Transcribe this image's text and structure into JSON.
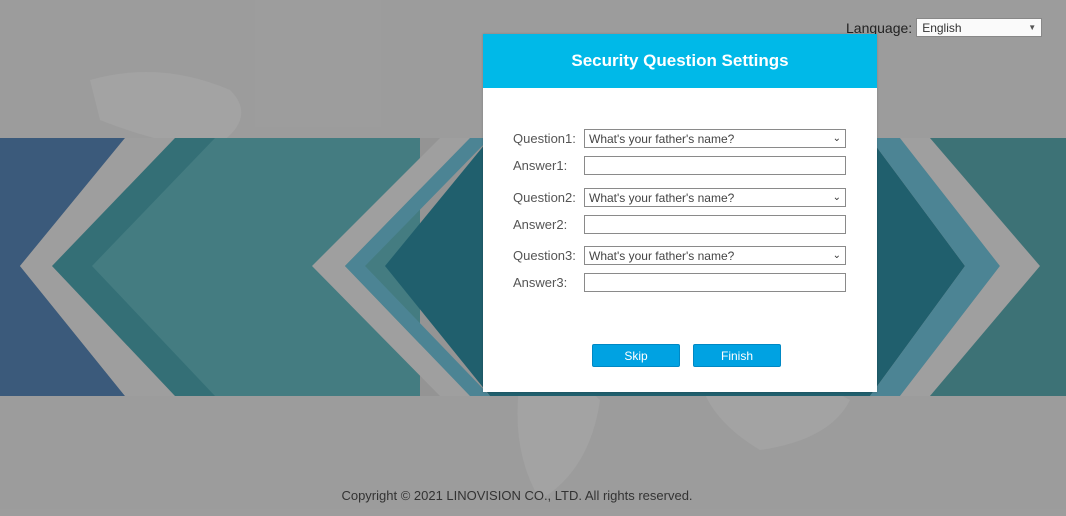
{
  "language": {
    "label": "Language:",
    "selected": "English"
  },
  "dialog": {
    "title": "Security Question Settings",
    "rows": [
      {
        "question_label": "Question1:",
        "question_value": "What's your father's name?",
        "answer_label": "Answer1:",
        "answer_value": ""
      },
      {
        "question_label": "Question2:",
        "question_value": "What's your father's name?",
        "answer_label": "Answer2:",
        "answer_value": ""
      },
      {
        "question_label": "Question3:",
        "question_value": "What's your father's name?",
        "answer_label": "Answer3:",
        "answer_value": ""
      }
    ],
    "skip_label": "Skip",
    "finish_label": "Finish"
  },
  "footer": {
    "copyright": "Copyright © 2021 LINOVISION CO., LTD. All rights reserved."
  },
  "colors": {
    "header": "#00b9e8",
    "button": "#00a2e2"
  }
}
